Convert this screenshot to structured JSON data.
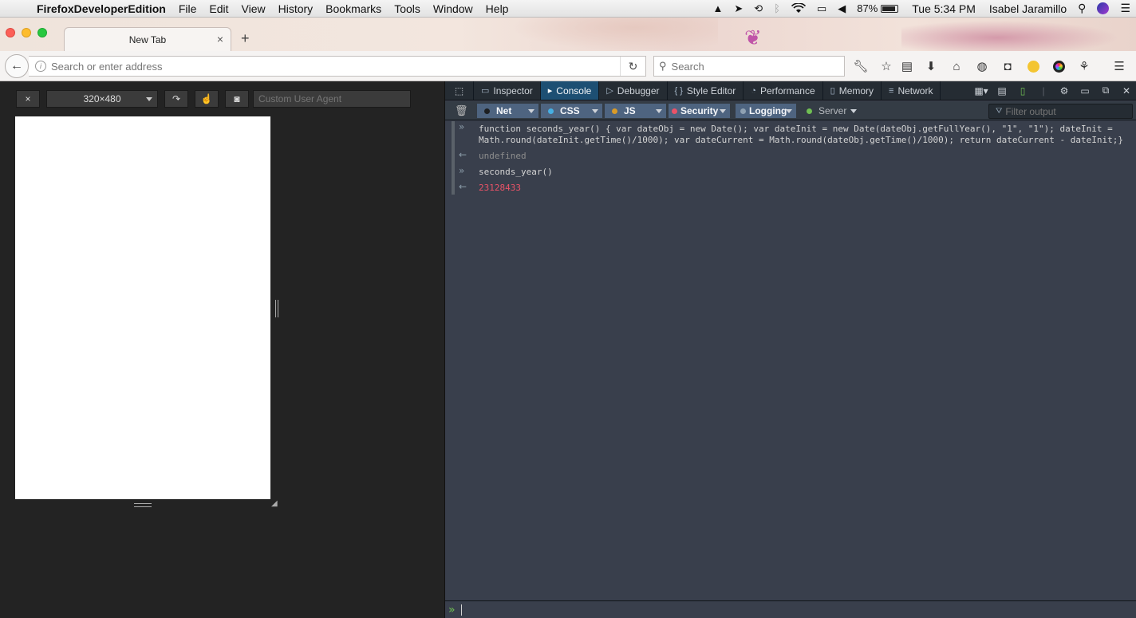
{
  "menubar": {
    "app_name": "FirefoxDeveloperEdition",
    "items": [
      "File",
      "Edit",
      "View",
      "History",
      "Bookmarks",
      "Tools",
      "Window",
      "Help"
    ],
    "battery": "87%",
    "battery_level": 0.87,
    "clock": "Tue 5:34 PM",
    "user": "Isabel Jaramillo"
  },
  "browser": {
    "tab_title": "New Tab",
    "url_placeholder": "Search or enter address",
    "search_placeholder": "Search"
  },
  "rdm": {
    "close": "×",
    "size": "320×480",
    "user_agent_placeholder": "Custom User Agent"
  },
  "devtools": {
    "tabs": [
      {
        "label": "Inspector",
        "icon": "inspector-icon"
      },
      {
        "label": "Console",
        "icon": "console-icon",
        "selected": true
      },
      {
        "label": "Debugger",
        "icon": "debugger-icon"
      },
      {
        "label": "Style Editor",
        "icon": "style-editor-icon"
      },
      {
        "label": "Performance",
        "icon": "performance-icon"
      },
      {
        "label": "Memory",
        "icon": "memory-icon"
      },
      {
        "label": "Network",
        "icon": "network-icon"
      }
    ],
    "filters": [
      {
        "label": "Net",
        "color": "#1d1f21",
        "on": true
      },
      {
        "label": "CSS",
        "color": "#46afe3",
        "on": true
      },
      {
        "label": "JS",
        "color": "#d99b28",
        "on": true
      },
      {
        "label": "Security",
        "color": "#eb5368",
        "on": true
      },
      {
        "label": "Logging",
        "color": "#8fa1b2",
        "on": true
      },
      {
        "label": "Server",
        "color": "#70bf53",
        "on": false
      }
    ],
    "filter_placeholder": "Filter output",
    "console": {
      "input1_line1": "function seconds_year() { var dateObj = new Date(); var dateInit = new Date(dateObj.getFullYear(), \"1\", \"1\"); dateInit =",
      "input1_line2": "Math.round(dateInit.getTime()/1000); var dateCurrent = Math.round(dateObj.getTime()/1000); return dateCurrent - dateInit;}",
      "output1": "undefined",
      "input2": "seconds_year()",
      "output2": "23128433"
    }
  }
}
